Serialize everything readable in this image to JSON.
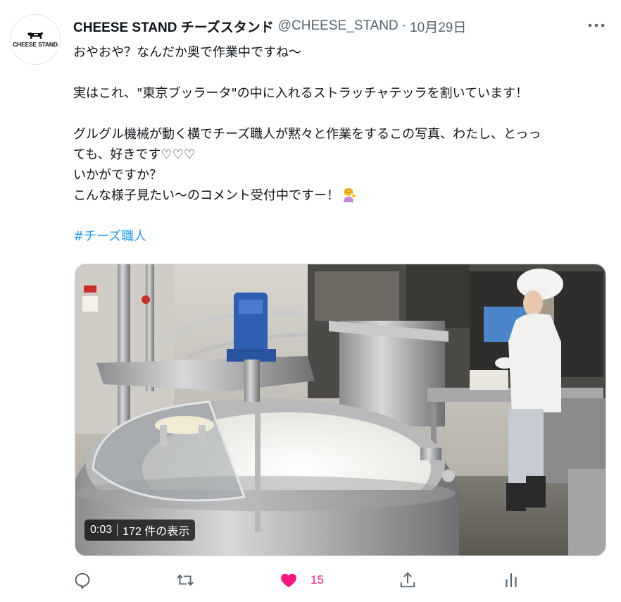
{
  "author": {
    "avatar_text": "CHEESE STAND",
    "display_name": "CHEESE STAND チーズスタンド",
    "handle": "@CHEESE_STAND",
    "separator": "·",
    "date": "10月29日"
  },
  "tweet": {
    "lines": [
      "おやおや？なんだか奥で作業中ですね〜",
      "実はこれ、\"東京ブッラータ\"の中に入れるストラッチャテッラを割いています！",
      "グルグル機械が動く横でチーズ職人が黙々と作業をするこの写真、わたし、とっっ",
      "ても、好きです♡♡♡",
      "いかがですか？",
      "こんな様子見たい〜のコメント受付中ですー！"
    ],
    "emoji": "person-tipping-hand-emoji",
    "hashtag": "#チーズ職人"
  },
  "media": {
    "duration": "0:03",
    "views": "172 件の表示"
  },
  "actions": {
    "like_count": "15",
    "like_color": "#f91880",
    "icons": [
      "reply-icon",
      "retweet-icon",
      "heart-icon",
      "share-icon",
      "analytics-icon"
    ]
  },
  "colors": {
    "hashtag": "#1d9bf0",
    "secondary_text": "#536471"
  }
}
